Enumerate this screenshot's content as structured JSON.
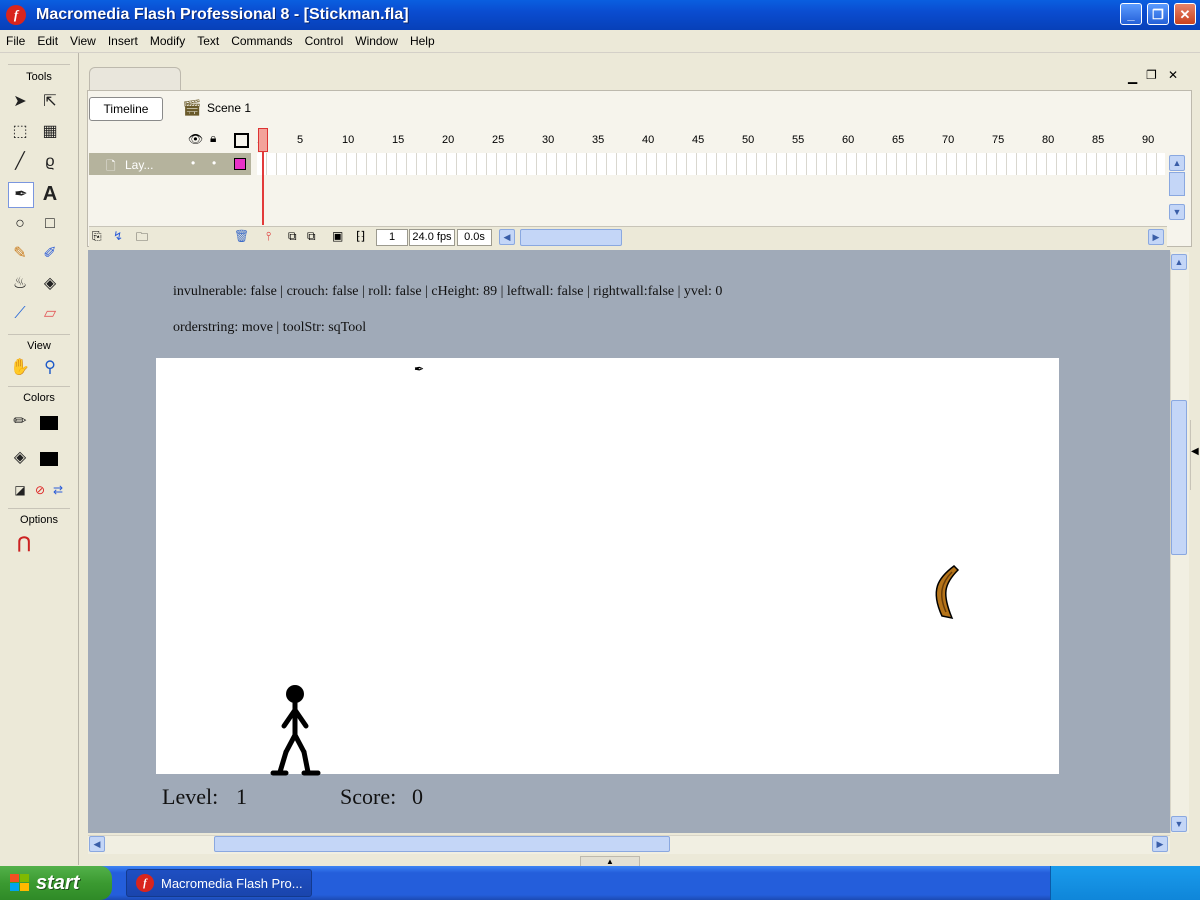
{
  "window": {
    "title": "Macromedia Flash Professional 8 - [Stickman.fla]",
    "app_icon_glyph": "f"
  },
  "menu": [
    "File",
    "Edit",
    "View",
    "Insert",
    "Modify",
    "Text",
    "Commands",
    "Control",
    "Window",
    "Help"
  ],
  "tools_panel": {
    "title": "Tools",
    "view_label": "View",
    "colors_label": "Colors",
    "options_label": "Options"
  },
  "timeline": {
    "button_label": "Timeline",
    "scene_label": "Scene 1",
    "layer_name": "Lay...",
    "ruler_ticks": [
      "1",
      "5",
      "10",
      "15",
      "20",
      "25",
      "30",
      "35",
      "40",
      "45",
      "50",
      "55",
      "60",
      "65",
      "70",
      "75",
      "80",
      "85",
      "90"
    ],
    "current_frame": "1",
    "frame_rate": "24.0 fps",
    "elapsed_time": "0.0s"
  },
  "stage": {
    "debug_line_1": "invulnerable: false | crouch: false | roll: false | cHeight: 89 | leftwall: false | rightwall:false | yvel: 0",
    "debug_line_2": "orderstring: move | toolStr: sqTool",
    "level_label": "Level:",
    "level_value": "1",
    "score_label": "Score:",
    "score_value": "0"
  },
  "taskbar": {
    "start_label": "start",
    "task_item_label": "Macromedia Flash Pro..."
  },
  "colors": {
    "title_bar": "#0a4cd0",
    "stage_background": "#ffffff",
    "pasteboard": "#a0aab8",
    "boomerang": "#b5741a"
  }
}
